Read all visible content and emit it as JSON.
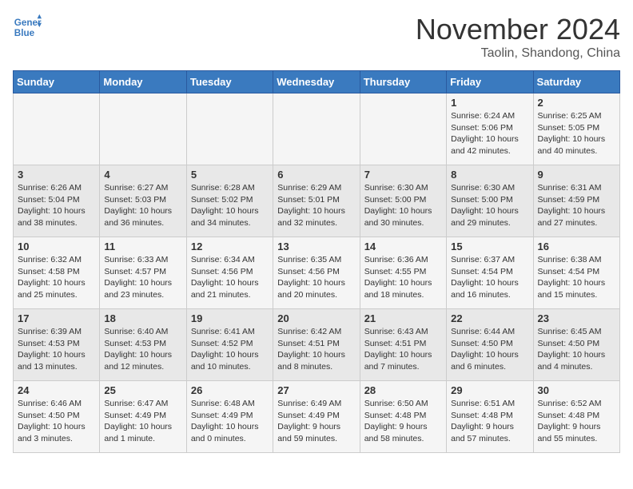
{
  "header": {
    "logo_line1": "General",
    "logo_line2": "Blue",
    "month": "November 2024",
    "location": "Taolin, Shandong, China"
  },
  "days_of_week": [
    "Sunday",
    "Monday",
    "Tuesday",
    "Wednesday",
    "Thursday",
    "Friday",
    "Saturday"
  ],
  "weeks": [
    [
      {
        "day": "",
        "info": ""
      },
      {
        "day": "",
        "info": ""
      },
      {
        "day": "",
        "info": ""
      },
      {
        "day": "",
        "info": ""
      },
      {
        "day": "",
        "info": ""
      },
      {
        "day": "1",
        "info": "Sunrise: 6:24 AM\nSunset: 5:06 PM\nDaylight: 10 hours and 42 minutes."
      },
      {
        "day": "2",
        "info": "Sunrise: 6:25 AM\nSunset: 5:05 PM\nDaylight: 10 hours and 40 minutes."
      }
    ],
    [
      {
        "day": "3",
        "info": "Sunrise: 6:26 AM\nSunset: 5:04 PM\nDaylight: 10 hours and 38 minutes."
      },
      {
        "day": "4",
        "info": "Sunrise: 6:27 AM\nSunset: 5:03 PM\nDaylight: 10 hours and 36 minutes."
      },
      {
        "day": "5",
        "info": "Sunrise: 6:28 AM\nSunset: 5:02 PM\nDaylight: 10 hours and 34 minutes."
      },
      {
        "day": "6",
        "info": "Sunrise: 6:29 AM\nSunset: 5:01 PM\nDaylight: 10 hours and 32 minutes."
      },
      {
        "day": "7",
        "info": "Sunrise: 6:30 AM\nSunset: 5:00 PM\nDaylight: 10 hours and 30 minutes."
      },
      {
        "day": "8",
        "info": "Sunrise: 6:30 AM\nSunset: 5:00 PM\nDaylight: 10 hours and 29 minutes."
      },
      {
        "day": "9",
        "info": "Sunrise: 6:31 AM\nSunset: 4:59 PM\nDaylight: 10 hours and 27 minutes."
      }
    ],
    [
      {
        "day": "10",
        "info": "Sunrise: 6:32 AM\nSunset: 4:58 PM\nDaylight: 10 hours and 25 minutes."
      },
      {
        "day": "11",
        "info": "Sunrise: 6:33 AM\nSunset: 4:57 PM\nDaylight: 10 hours and 23 minutes."
      },
      {
        "day": "12",
        "info": "Sunrise: 6:34 AM\nSunset: 4:56 PM\nDaylight: 10 hours and 21 minutes."
      },
      {
        "day": "13",
        "info": "Sunrise: 6:35 AM\nSunset: 4:56 PM\nDaylight: 10 hours and 20 minutes."
      },
      {
        "day": "14",
        "info": "Sunrise: 6:36 AM\nSunset: 4:55 PM\nDaylight: 10 hours and 18 minutes."
      },
      {
        "day": "15",
        "info": "Sunrise: 6:37 AM\nSunset: 4:54 PM\nDaylight: 10 hours and 16 minutes."
      },
      {
        "day": "16",
        "info": "Sunrise: 6:38 AM\nSunset: 4:54 PM\nDaylight: 10 hours and 15 minutes."
      }
    ],
    [
      {
        "day": "17",
        "info": "Sunrise: 6:39 AM\nSunset: 4:53 PM\nDaylight: 10 hours and 13 minutes."
      },
      {
        "day": "18",
        "info": "Sunrise: 6:40 AM\nSunset: 4:53 PM\nDaylight: 10 hours and 12 minutes."
      },
      {
        "day": "19",
        "info": "Sunrise: 6:41 AM\nSunset: 4:52 PM\nDaylight: 10 hours and 10 minutes."
      },
      {
        "day": "20",
        "info": "Sunrise: 6:42 AM\nSunset: 4:51 PM\nDaylight: 10 hours and 8 minutes."
      },
      {
        "day": "21",
        "info": "Sunrise: 6:43 AM\nSunset: 4:51 PM\nDaylight: 10 hours and 7 minutes."
      },
      {
        "day": "22",
        "info": "Sunrise: 6:44 AM\nSunset: 4:50 PM\nDaylight: 10 hours and 6 minutes."
      },
      {
        "day": "23",
        "info": "Sunrise: 6:45 AM\nSunset: 4:50 PM\nDaylight: 10 hours and 4 minutes."
      }
    ],
    [
      {
        "day": "24",
        "info": "Sunrise: 6:46 AM\nSunset: 4:50 PM\nDaylight: 10 hours and 3 minutes."
      },
      {
        "day": "25",
        "info": "Sunrise: 6:47 AM\nSunset: 4:49 PM\nDaylight: 10 hours and 1 minute."
      },
      {
        "day": "26",
        "info": "Sunrise: 6:48 AM\nSunset: 4:49 PM\nDaylight: 10 hours and 0 minutes."
      },
      {
        "day": "27",
        "info": "Sunrise: 6:49 AM\nSunset: 4:49 PM\nDaylight: 9 hours and 59 minutes."
      },
      {
        "day": "28",
        "info": "Sunrise: 6:50 AM\nSunset: 4:48 PM\nDaylight: 9 hours and 58 minutes."
      },
      {
        "day": "29",
        "info": "Sunrise: 6:51 AM\nSunset: 4:48 PM\nDaylight: 9 hours and 57 minutes."
      },
      {
        "day": "30",
        "info": "Sunrise: 6:52 AM\nSunset: 4:48 PM\nDaylight: 9 hours and 55 minutes."
      }
    ]
  ]
}
